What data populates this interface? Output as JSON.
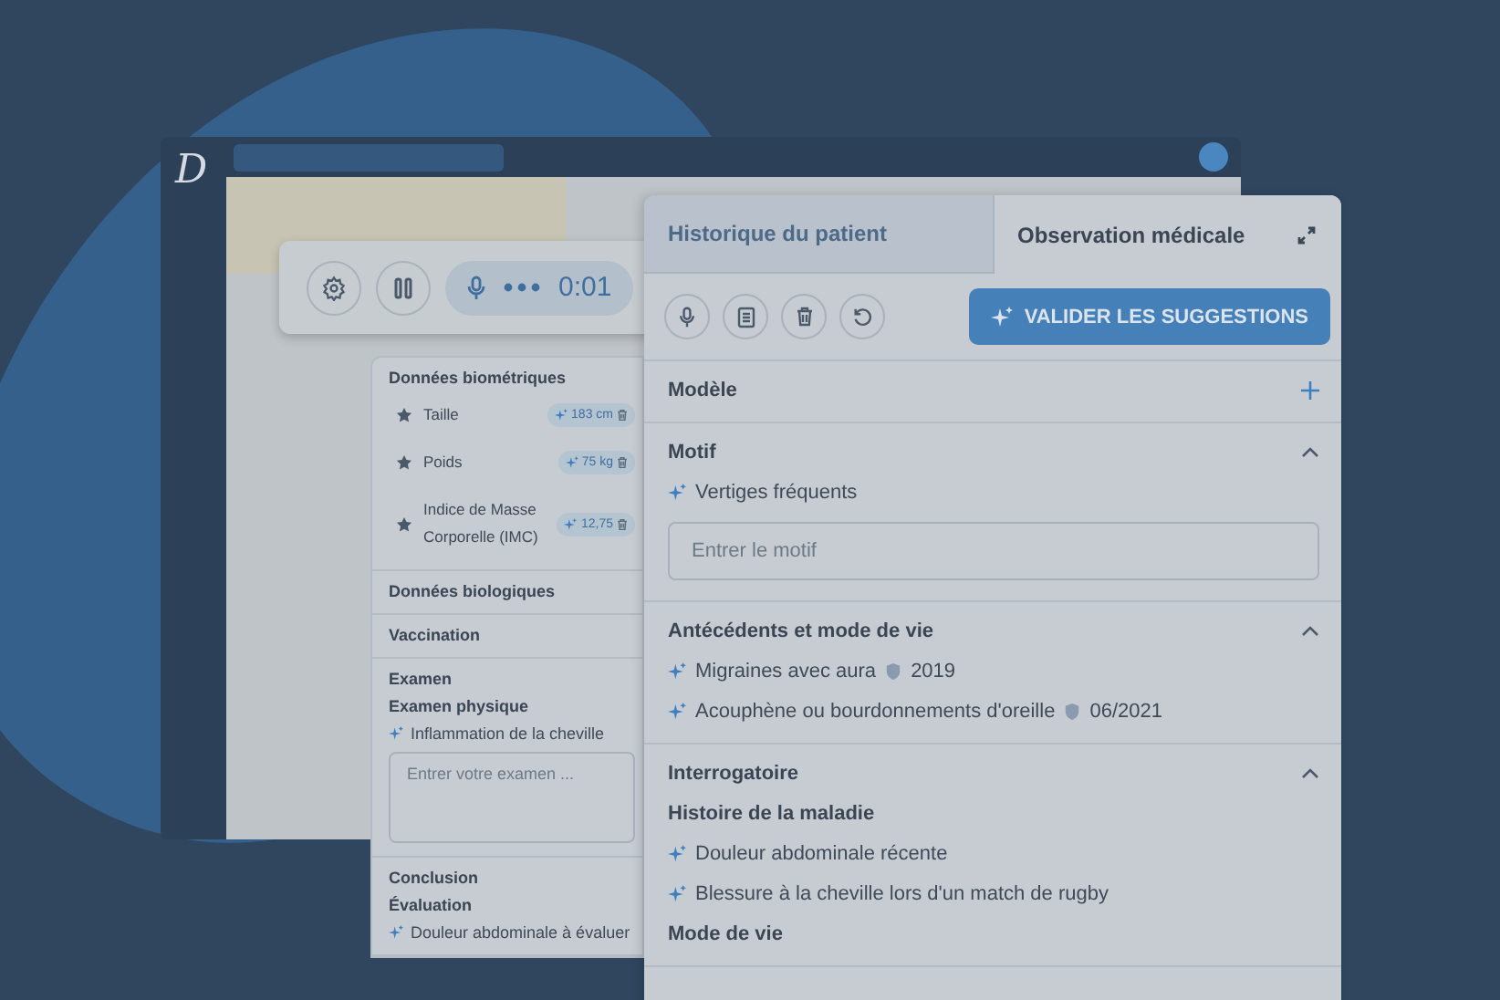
{
  "app_window": {
    "logo": "D"
  },
  "recorder": {
    "timer": "0:01"
  },
  "left_panel": {
    "sections": [
      {
        "title": "Données biométriques",
        "kind": "biometrics",
        "rows": [
          {
            "label": "Taille",
            "value": "183 cm"
          },
          {
            "label": "Poids",
            "value": "75 kg"
          },
          {
            "label": "Indice de Masse Corporelle (IMC)",
            "value": "12,75"
          }
        ]
      },
      {
        "title": "Données biologiques",
        "kind": "header"
      },
      {
        "title": "Vaccination",
        "kind": "header"
      },
      {
        "title": "Examen",
        "kind": "group",
        "subtitle": "Examen physique",
        "suggestions": [
          "Inflammation de la cheville"
        ],
        "placeholder": "Entrer votre examen ..."
      },
      {
        "title": "Conclusion",
        "kind": "group",
        "subtitle": "Évaluation",
        "suggestions": [
          "Douleur abdominale à évaluer"
        ]
      }
    ]
  },
  "right_panel": {
    "tabs": [
      {
        "label": "Historique du patient",
        "selected": false
      },
      {
        "label": "Observation médicale",
        "selected": true
      }
    ],
    "validate_button": "VALIDER LES SUGGESTIONS",
    "sections": [
      {
        "title": "Modèle",
        "expanded": false
      },
      {
        "title": "Motif",
        "expanded": true,
        "suggestions": [
          {
            "text": "Vertiges fréquents"
          }
        ],
        "placeholder": "Entrer le motif"
      },
      {
        "title": "Antécédents et mode de vie",
        "expanded": true,
        "suggestions": [
          {
            "text": "Migraines avec aura",
            "date": "2019"
          },
          {
            "text": "Acouphène ou bourdonnements d'oreille",
            "date": "06/2021"
          }
        ]
      },
      {
        "title": "Interrogatoire",
        "expanded": true,
        "subsections": [
          {
            "title": "Histoire de la maladie",
            "suggestions": [
              "Douleur abdominale récente",
              "Blessure à la cheville lors d'un match de rugby"
            ]
          },
          {
            "title": "Mode de vie"
          }
        ]
      }
    ]
  }
}
